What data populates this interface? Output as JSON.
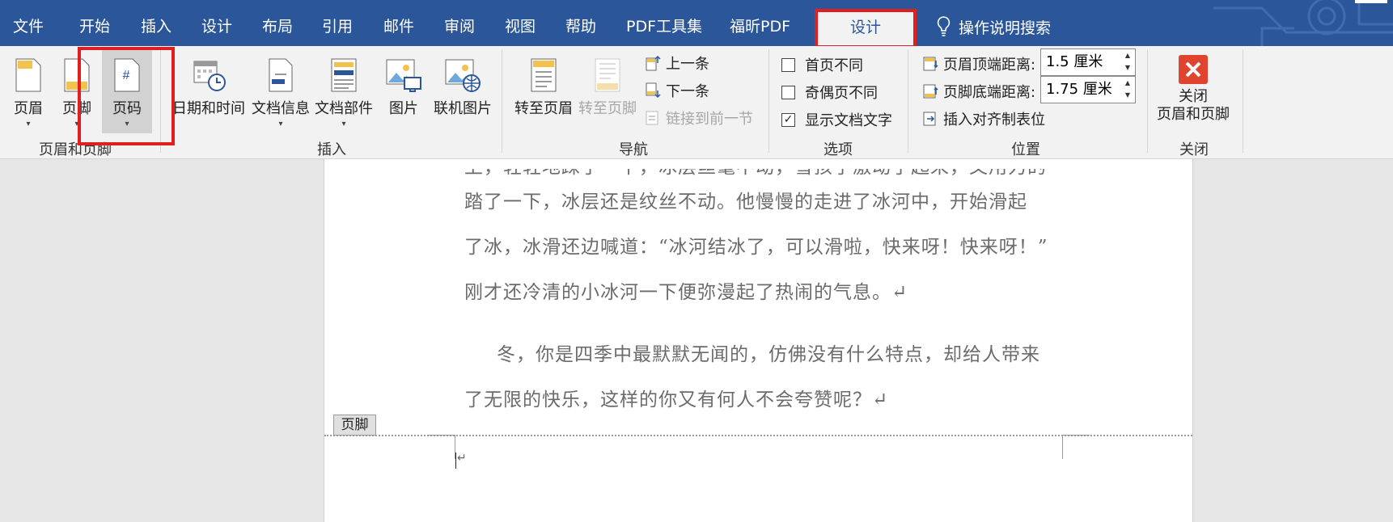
{
  "tabs": {
    "file": "文件",
    "home": "开始",
    "insert": "插入",
    "design": "设计",
    "layout": "布局",
    "references": "引用",
    "mailings": "邮件",
    "review": "审阅",
    "view": "视图",
    "help": "帮助",
    "pdf_tools": "PDF工具集",
    "foxit_pdf": "福昕PDF",
    "design_active": "设计",
    "tell_me": "操作说明搜索"
  },
  "ribbon": {
    "header_footer_group": {
      "header": "页眉",
      "footer": "页脚",
      "page_number": "页码",
      "page_number_icon": "#",
      "label": "页眉和页脚"
    },
    "insert_group": {
      "date_time": "日期和时间",
      "doc_info": "文档信息",
      "doc_parts": "文档部件",
      "picture": "图片",
      "online_picture": "联机图片",
      "label": "插入"
    },
    "navigation_group": {
      "go_to_header": "转至页眉",
      "go_to_footer": "转至页脚",
      "previous": "上一条",
      "next": "下一条",
      "link_to_previous": "链接到前一节",
      "label": "导航"
    },
    "options_group": {
      "different_first_page": "首页不同",
      "different_first_page_checked": false,
      "different_odd_even": "奇偶页不同",
      "different_odd_even_checked": false,
      "show_doc_text": "显示文档文字",
      "show_doc_text_checked": true,
      "label": "选项"
    },
    "position_group": {
      "header_from_top_label": "页眉顶端距离:",
      "header_from_top_value": "1.5 厘米",
      "footer_from_bottom_label": "页脚底端距离:",
      "footer_from_bottom_value": "1.75 厘米",
      "insert_alignment_tab": "插入对齐制表位",
      "label": "位置"
    },
    "close_group": {
      "close_line1": "关闭",
      "close_line2": "页眉和页脚",
      "label": "关闭"
    }
  },
  "document": {
    "partial_top": "上，轻轻地踩了一下，冰层丝毫不动，雪孩子激动了起来，又用力的",
    "lines": [
      "踏了一下，冰层还是纹丝不动。他慢慢的走进了冰河中，开始滑起",
      "了冰，冰滑还边喊道：“冰河结冰了，可以滑啦，快来呀！快来呀！”",
      "刚才还冷清的小冰河一下便弥漫起了热闹的气息。↵",
      "冬，你是四季中最默默无闻的，仿佛没有什么特点，却给人带来",
      "了无限的快乐，这样的你又有何人不会夸赞呢？↵"
    ],
    "footer_tag": "页脚",
    "footer_para_mark": "↵"
  },
  "colors": {
    "ribbon_blue": "#2b579a",
    "highlight_red": "#e02020",
    "close_red": "#e0432e"
  },
  "icons": [
    "header-icon",
    "footer-icon",
    "page-number-icon",
    "date-time-icon",
    "doc-info-icon",
    "doc-parts-icon",
    "picture-icon",
    "online-picture-icon",
    "go-to-header-icon",
    "go-to-footer-icon",
    "previous-icon",
    "next-icon",
    "link-icon",
    "header-top-icon",
    "footer-bottom-icon",
    "alignment-tab-icon",
    "close-icon",
    "lightbulb-icon"
  ]
}
